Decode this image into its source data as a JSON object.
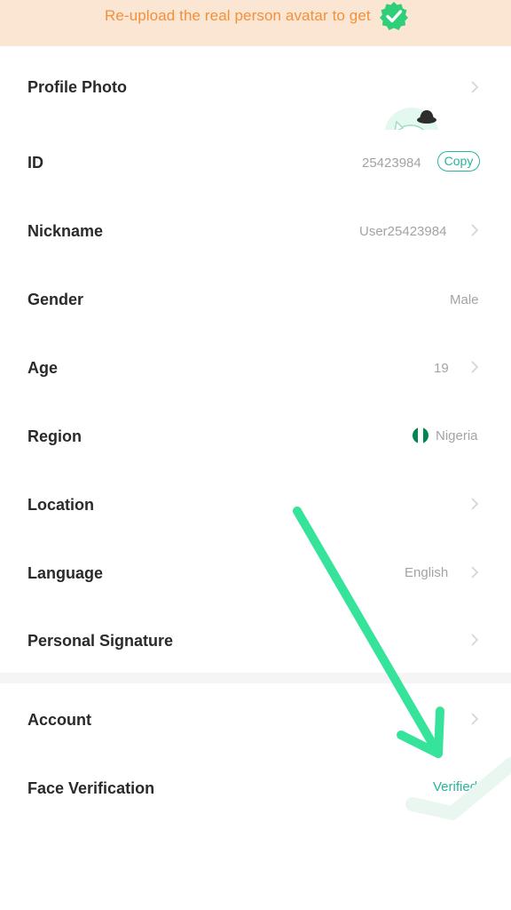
{
  "banner": {
    "text": "Re-upload the real person avatar to get",
    "badge_icon": "verified-check-badge-icon",
    "background": "#fbe5d3",
    "text_color": "#f2913a",
    "badge_color": "#2fcf7a"
  },
  "profile": {
    "rows": [
      {
        "label": "Profile Photo",
        "value": ""
      },
      {
        "label": "ID",
        "value": "25423984",
        "action": "Copy"
      },
      {
        "label": "Nickname",
        "value": "User25423984"
      },
      {
        "label": "Gender",
        "value": "Male"
      },
      {
        "label": "Age",
        "value": "19"
      },
      {
        "label": "Region",
        "value": "Nigeria",
        "flag_icon": "nigeria-flag-icon"
      },
      {
        "label": "Location",
        "value": ""
      },
      {
        "label": "Language",
        "value": "English"
      },
      {
        "label": "Personal Signature",
        "value": ""
      }
    ]
  },
  "account": {
    "rows": [
      {
        "label": "Account",
        "value": ""
      },
      {
        "label": "Face Verification",
        "value": "Verified"
      }
    ]
  },
  "colors": {
    "accent": "#27b59b",
    "label": "#2a2a2a",
    "muted": "#a3a3a3",
    "chevron": "#d6d6d6",
    "annotation_arrow": "#35e39a"
  }
}
